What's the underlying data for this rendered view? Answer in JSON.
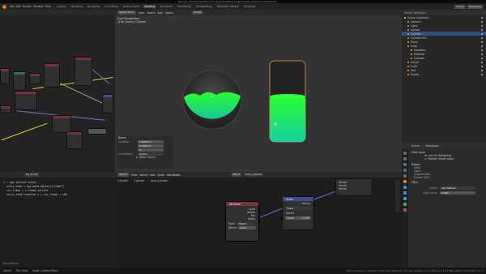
{
  "window_title": "Blender [/home/chris/Documents/art/building project/waste sale/land_jelly.blend]",
  "menu": [
    "File",
    "Edit",
    "Render",
    "Window",
    "Help"
  ],
  "workspaces": [
    {
      "label": "Layout",
      "active": false
    },
    {
      "label": "Modeling",
      "active": false
    },
    {
      "label": "Sculpting",
      "active": false
    },
    {
      "label": "UV Editing",
      "active": false
    },
    {
      "label": "Texture Paint",
      "active": false
    },
    {
      "label": "Shading",
      "active": true
    },
    {
      "label": "Animation",
      "active": false
    },
    {
      "label": "Rendering",
      "active": false
    },
    {
      "label": "Compositing",
      "active": false
    },
    {
      "label": "Geometry Nodes",
      "active": false
    },
    {
      "label": "Scripting",
      "active": false
    }
  ],
  "scene_label": "Scene",
  "view_layer_label": "ViewLayer",
  "viewport": {
    "header_items": [
      "Object Mode",
      "View",
      "Select",
      "Add",
      "Object",
      "Global"
    ],
    "info_line1": "User Perspective",
    "info_line2": "(218) Scene | Cylinder",
    "panel_title": "Blend",
    "panel_rows": [
      {
        "label": "Location",
        "value": "0.0000 m"
      },
      {
        "label": "",
        "value": "0.0000 m"
      },
      {
        "label": "",
        "value": "0"
      },
      {
        "label": "Orientation",
        "value": "Global"
      },
      {
        "label": "",
        "value": "Show Gizmo"
      },
      {
        "label": "",
        "value": "Show Overlay"
      }
    ]
  },
  "outliner": {
    "title": "Scene Collection",
    "rows": [
      {
        "label": "Scene Collection",
        "selected": false,
        "indent": 0
      },
      {
        "label": "Camera",
        "selected": false,
        "indent": 1
      },
      {
        "label": "Light",
        "selected": false,
        "indent": 1
      },
      {
        "label": "Sphere",
        "selected": false,
        "indent": 1
      },
      {
        "label": "Cylinder",
        "selected": true,
        "indent": 1
      },
      {
        "label": "Cylinder.001",
        "selected": false,
        "indent": 1
      },
      {
        "label": "Plane",
        "selected": false,
        "indent": 1
      },
      {
        "label": "Cube",
        "selected": false,
        "indent": 1
      },
      {
        "label": "Modifiers",
        "selected": false,
        "indent": 2
      },
      {
        "label": "Material",
        "selected": false,
        "indent": 2
      },
      {
        "label": "Cylinder",
        "selected": false,
        "indent": 2
      },
      {
        "label": "Liquid",
        "selected": false,
        "indent": 1
      },
      {
        "label": "Fluid",
        "selected": false,
        "indent": 1
      },
      {
        "label": "Text",
        "selected": false,
        "indent": 1
      },
      {
        "label": "Empty",
        "selected": false,
        "indent": 1
      }
    ]
  },
  "properties": {
    "header": "Scene",
    "sub_header": "ViewLayer",
    "section1": "View Layer",
    "checks": [
      {
        "label": "Use for Rendering",
        "checked": true
      },
      {
        "label": "Render Single Layer",
        "checked": false
      }
    ],
    "section2": "Passes",
    "passes": [
      "Data",
      "Light",
      "Cryptomatte",
      "Shader AOV"
    ],
    "section3": "Filter",
    "light_label": "Lights",
    "light_value": "self-defined",
    "value_label": "Light Value",
    "value": "0.000"
  },
  "text_editor": {
    "header": "My Script",
    "lines": [
      "s = bpy.context.scene",
      "",
      "  entry_item = bpy.data.objects[\"Cube\"]",
      "  cur_frame = s.frame_current",
      "",
      "  entry_item.location.z = cur_frame / 100",
      "",
      ""
    ],
    "footer": "Text Internal"
  },
  "node_editor": {
    "header_items": [
      "Object",
      "View",
      "Select",
      "Add",
      "Node",
      "Use Nodes"
    ],
    "slot": "Slot 1",
    "material": "land_cylinder",
    "breadcrumb": [
      "Cylinder",
      "Cylinder",
      "land_cylinder"
    ],
    "attr_node": {
      "title": "Attribute",
      "outputs": [
        "Color",
        "Vector",
        "Fac",
        "Alpha"
      ],
      "type_label": "Type:",
      "type_value": "Object",
      "name_label": "Name:",
      "name_value": "level"
    },
    "scale_node": {
      "title": "Scale",
      "output": "Vector",
      "op": "Scale",
      "input": "Vector",
      "scale_label": "Scale",
      "scale_value": "0.500"
    },
    "vector_node": {
      "rows": [
        "Vector",
        "Vector",
        "Vector"
      ]
    }
  },
  "status": {
    "left": "Select",
    "mid": "Pan View",
    "right_btn": "Node Context Menu",
    "info": "Scene Collection | Cylinder | Verts 128 | Faces 66 | Tris 252 | Objects 1/14 | Memory 152.8 MiB | VRAM 1.3/8.0 GiB | 3.5.1"
  },
  "colors": {
    "accent": "#4772b3",
    "liquid": "#22e860",
    "glass_outline": "#e8a040",
    "node_attr_header": "#7a2f3d",
    "node_vector_header": "#3b4f8c"
  }
}
